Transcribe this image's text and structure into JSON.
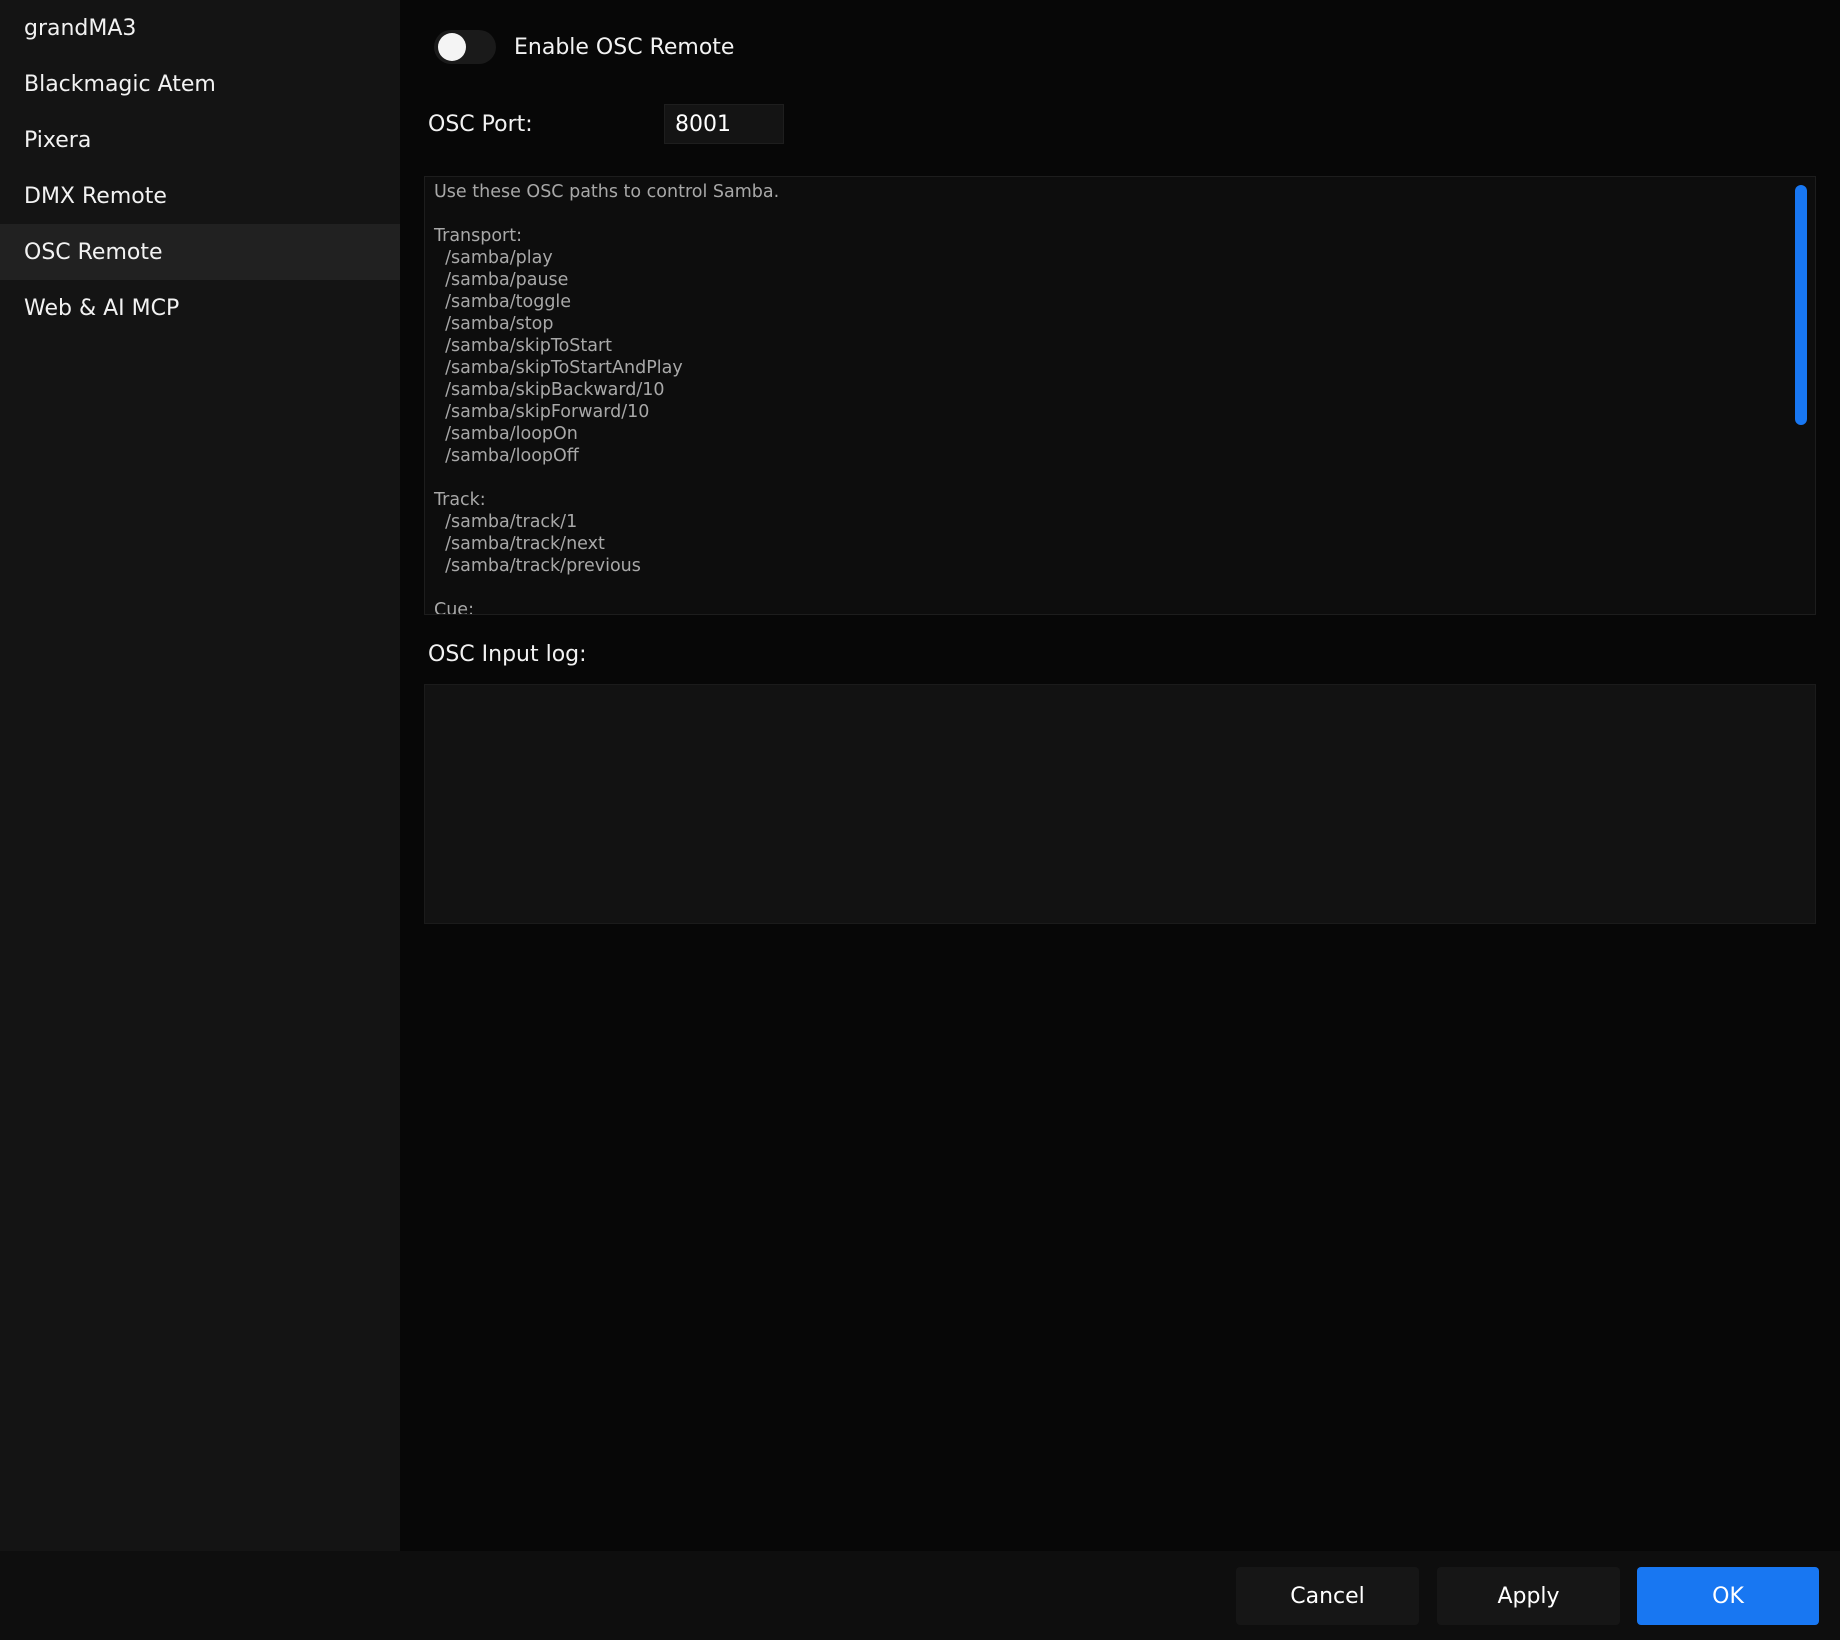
{
  "sidebar": {
    "items": [
      {
        "label": "grandMA3"
      },
      {
        "label": "Blackmagic Atem"
      },
      {
        "label": "Pixera"
      },
      {
        "label": "DMX Remote"
      },
      {
        "label": "OSC Remote",
        "active": true
      },
      {
        "label": "Web & AI MCP"
      }
    ]
  },
  "main": {
    "enable_label": "Enable OSC Remote",
    "enable_state": false,
    "port_label": "OSC Port:",
    "port_value": "8001",
    "help_lines": [
      "Use these OSC paths to control Samba.",
      "",
      "Transport:",
      "  /samba/play",
      "  /samba/pause",
      "  /samba/toggle",
      "  /samba/stop",
      "  /samba/skipToStart",
      "  /samba/skipToStartAndPlay",
      "  /samba/skipBackward/10",
      "  /samba/skipForward/10",
      "  /samba/loopOn",
      "  /samba/loopOff",
      "",
      "Track:",
      "  /samba/track/1",
      "  /samba/track/next",
      "  /samba/track/previous",
      "",
      "Cue:"
    ],
    "log_label": "OSC Input log:",
    "log_content": ""
  },
  "footer": {
    "cancel_label": "Cancel",
    "apply_label": "Apply",
    "ok_label": "OK"
  },
  "colors": {
    "accent": "#1877f2",
    "background": "#070707",
    "sidebar_bg": "#141414",
    "sidebar_active_bg": "#212121"
  }
}
